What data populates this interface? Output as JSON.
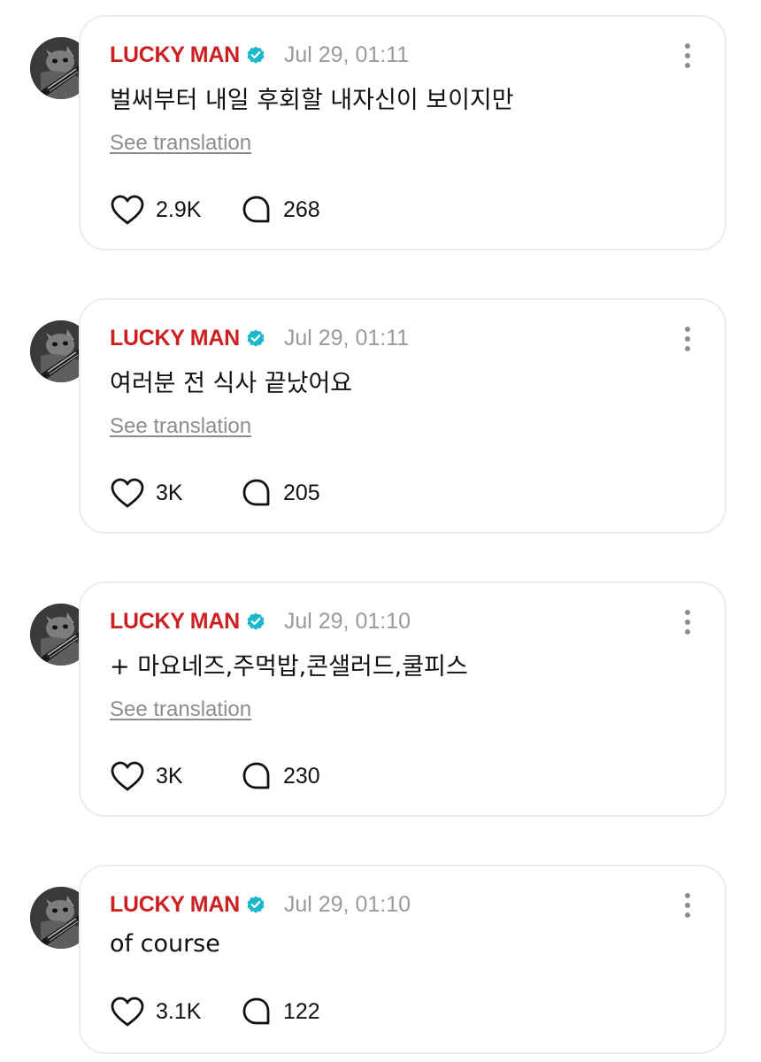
{
  "posts": [
    {
      "username": "LUCKY MAN",
      "timestamp": "Jul 29, 01:11",
      "text": "벌써부터 내일 후회할 내자신이 보이지만",
      "translation_label": "See translation",
      "likes": "2.9K",
      "replies": "268"
    },
    {
      "username": "LUCKY MAN",
      "timestamp": "Jul 29, 01:11",
      "text": "여러분 전 식사 끝났어요",
      "translation_label": "See translation",
      "likes": "3K",
      "replies": "205"
    },
    {
      "username": "LUCKY MAN",
      "timestamp": "Jul 29, 01:10",
      "text": "+ 마요네즈,주먹밥,콘샐러드,쿨피스",
      "translation_label": "See translation",
      "likes": "3K",
      "replies": "230"
    },
    {
      "username": "LUCKY MAN",
      "timestamp": "Jul 29, 01:10",
      "text": "of course",
      "likes": "3.1K",
      "replies": "122"
    }
  ],
  "icons": {
    "verified": "verified-badge-icon",
    "more": "more-vertical-icon",
    "like": "heart-icon",
    "reply": "reply-bubble-icon"
  },
  "colors": {
    "username": "#cc1f1f",
    "verified": "#1ab8c9",
    "timestamp": "#9a9a9a",
    "card_border": "#ececec"
  }
}
